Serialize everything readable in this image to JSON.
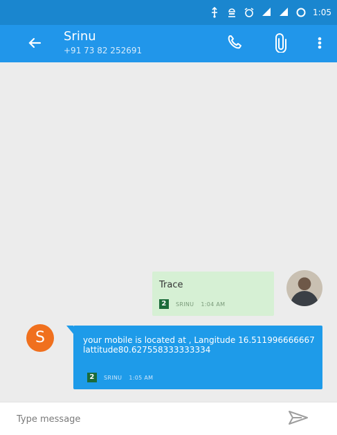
{
  "status_bar": {
    "time": "1:05",
    "icons": [
      "usb-icon",
      "android-debug-icon",
      "alarm-icon",
      "signal-icon",
      "signal-icon",
      "battery-icon"
    ]
  },
  "app_bar": {
    "contact_name": "Srinu",
    "contact_phone": "+91 73 82 252691",
    "back_icon": "arrow-left-icon",
    "call_icon": "phone-icon",
    "attach_icon": "paperclip-icon",
    "menu_icon": "more-vert-icon"
  },
  "messages": [
    {
      "direction": "outgoing",
      "text": "Trace",
      "sim": "2",
      "sender": "SRINU",
      "time": "1:04 AM"
    },
    {
      "direction": "incoming",
      "avatar_letter": "S",
      "text": "your mobile is located at , Langitude 16.511996666667 lattitude80.627558333333334",
      "sim": "2",
      "sender": "SRINU",
      "time": "1:05 AM"
    }
  ],
  "composer": {
    "placeholder": "Type message",
    "send_icon": "send-icon"
  },
  "colors": {
    "status_bar": "#1a86cf",
    "app_bar": "#2196ea",
    "incoming_bubble": "#1e9be9",
    "outgoing_bubble": "#d6f0d4",
    "avatar_s": "#f0701e"
  }
}
